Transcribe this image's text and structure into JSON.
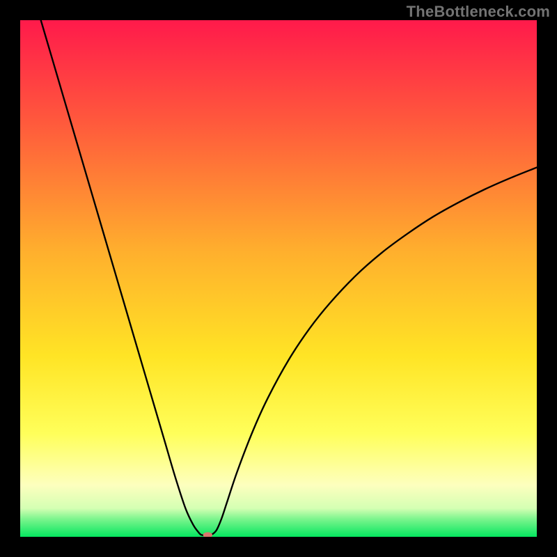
{
  "watermark": "TheBottleneck.com",
  "chart_data": {
    "type": "line",
    "title": "",
    "xlabel": "",
    "ylabel": "",
    "xlim": [
      0,
      100
    ],
    "ylim": [
      0,
      100
    ],
    "grid": false,
    "legend": false,
    "gradient_stops": [
      {
        "offset": 0.0,
        "color": "#ff1a4b"
      },
      {
        "offset": 0.2,
        "color": "#ff5a3c"
      },
      {
        "offset": 0.45,
        "color": "#ffb02d"
      },
      {
        "offset": 0.65,
        "color": "#ffe425"
      },
      {
        "offset": 0.8,
        "color": "#ffff5a"
      },
      {
        "offset": 0.9,
        "color": "#fdffbe"
      },
      {
        "offset": 0.945,
        "color": "#d4ffb3"
      },
      {
        "offset": 0.965,
        "color": "#7ef58e"
      },
      {
        "offset": 1.0,
        "color": "#05e65f"
      }
    ],
    "series": [
      {
        "name": "bottleneck-curve",
        "type": "line",
        "x": [
          4,
          6,
          8,
          10,
          12,
          14,
          16,
          18,
          20,
          22,
          24,
          26,
          28,
          30,
          32,
          33.5,
          34.5,
          35,
          35.5,
          36,
          37,
          38,
          39,
          40,
          42,
          45,
          48,
          52,
          56,
          60,
          65,
          70,
          75,
          80,
          85,
          90,
          95,
          100
        ],
        "y": [
          100,
          93.2,
          86.4,
          79.6,
          72.8,
          66.0,
          59.2,
          52.4,
          45.6,
          38.8,
          32.0,
          25.2,
          18.4,
          11.6,
          5.5,
          2.3,
          0.9,
          0.4,
          0.3,
          0.3,
          0.4,
          1.3,
          3.6,
          6.6,
          12.6,
          20.4,
          27.0,
          34.3,
          40.3,
          45.3,
          50.6,
          55.0,
          58.7,
          62.0,
          64.8,
          67.3,
          69.5,
          71.5
        ]
      }
    ],
    "marker": {
      "x": 36.3,
      "y": 0.35,
      "rx": 0.9,
      "ry": 0.55,
      "color": "#d9786d"
    }
  }
}
